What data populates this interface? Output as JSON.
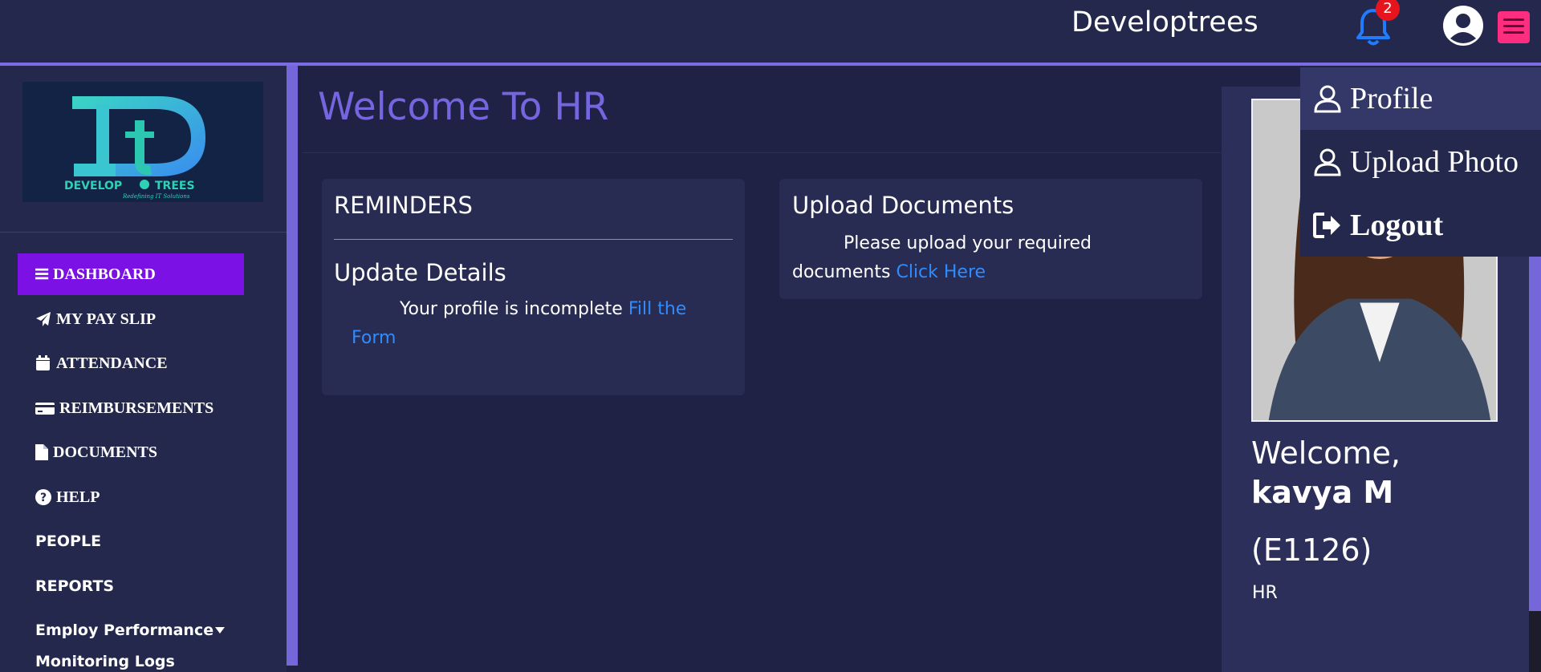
{
  "header": {
    "brand": "Developtrees",
    "notifications_count": "2"
  },
  "sidebar": {
    "logo_text": "DEVELOPTREES",
    "logo_tagline": "Redefining IT Solutions",
    "items": [
      {
        "label": "DASHBOARD",
        "icon": "bars-icon",
        "active": true
      },
      {
        "label": "MY PAY SLIP",
        "icon": "paper-plane-icon"
      },
      {
        "label": "ATTENDANCE",
        "icon": "calendar-icon"
      },
      {
        "label": "REIMBURSEMENTS",
        "icon": "credit-card-icon"
      },
      {
        "label": "DOCUMENTS",
        "icon": "file-icon"
      },
      {
        "label": "HELP",
        "icon": "question-circle-icon"
      },
      {
        "label": "PEOPLE"
      },
      {
        "label": "REPORTS"
      },
      {
        "label": "Employ Performance",
        "icon": "caret-down-icon"
      },
      {
        "label": "Monitoring Logs"
      }
    ]
  },
  "main": {
    "title": "Welcome To HR",
    "reminders": {
      "heading": "REMINDERS",
      "sub_heading": "Update Details",
      "text": "Your profile is incomplete",
      "link": "Fill the Form"
    },
    "upload": {
      "heading": "Upload Documents",
      "text_line1": "Please upload your required",
      "text_line2": "documents",
      "link": "Click Here"
    }
  },
  "profile": {
    "welcome": "Welcome,",
    "name": "kavya M",
    "employee_id": "(E1126)",
    "role": "HR"
  },
  "dropdown": {
    "items": [
      {
        "label": "Profile",
        "icon": "user-icon"
      },
      {
        "label": "Upload Photo",
        "icon": "user-icon"
      },
      {
        "label": "Logout",
        "icon": "sign-out-icon"
      }
    ]
  },
  "colors": {
    "accent": "#7566e0",
    "active_nav": "#7c11e6",
    "link": "#2f8cff",
    "badge": "#e8141d",
    "menu_button": "#ff2d7f"
  }
}
